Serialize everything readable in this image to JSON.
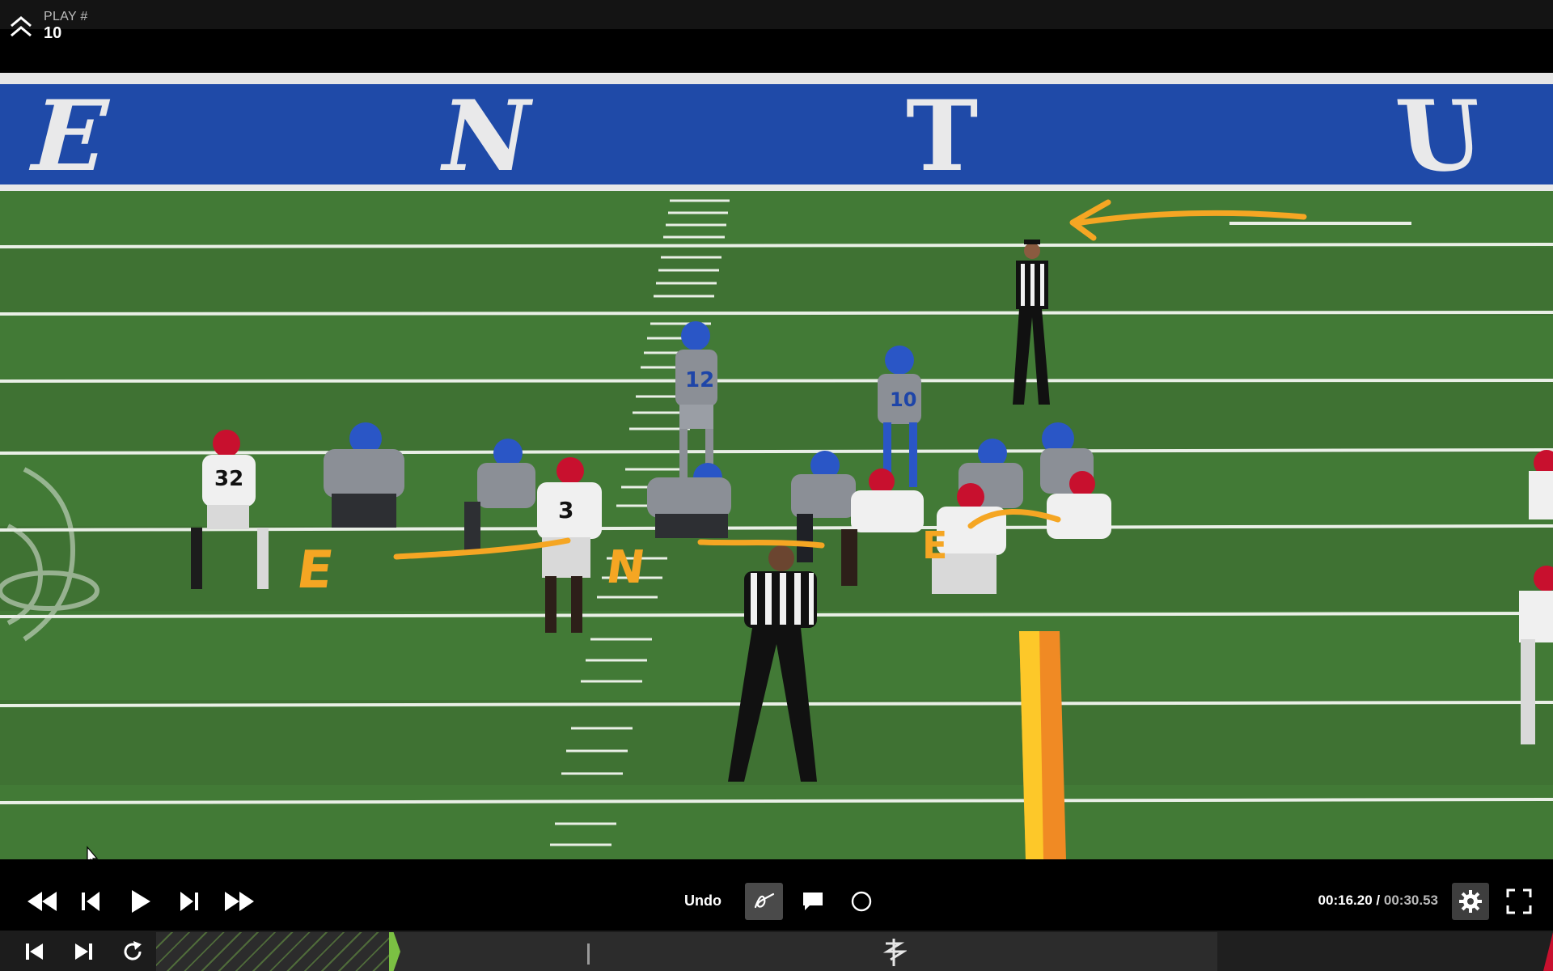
{
  "header": {
    "play_label": "PLAY #",
    "play_number": "10"
  },
  "video": {
    "endzone_letters": [
      "E",
      "N",
      "T",
      "U"
    ],
    "players": {
      "defense": [
        "32",
        "3"
      ],
      "offense_qb": "12",
      "offense_back": "10"
    }
  },
  "annotations": {
    "labels": [
      "E",
      "N",
      "E"
    ]
  },
  "controls": {
    "undo_label": "Undo",
    "time_current": "00:16.20",
    "time_separator": "/",
    "time_total": "00:30.53",
    "progress_fraction": 0.531
  },
  "colors": {
    "accent_green": "#7bc043",
    "annotation_orange": "#f5a623",
    "field_green": "#3d6e31",
    "endzone_blue": "#1f4aa8"
  }
}
